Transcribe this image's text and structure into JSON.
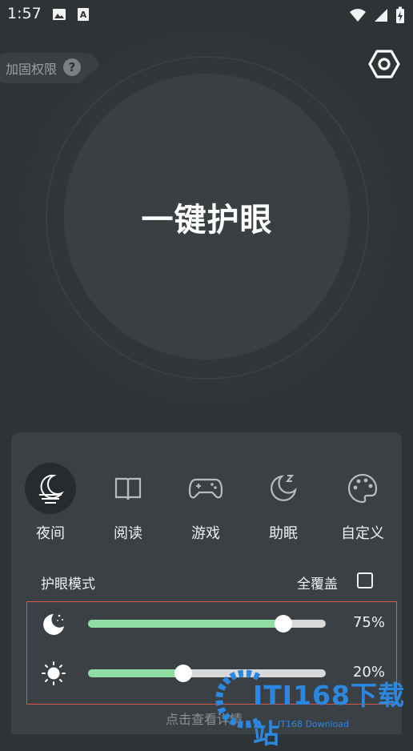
{
  "status_bar": {
    "time": "1:57",
    "left_icons": [
      "image-icon",
      "text-a-icon"
    ],
    "right_icons": [
      "wifi-icon",
      "signal-icon",
      "battery-charging-icon"
    ]
  },
  "permission": {
    "label": "加固权限",
    "help": "?"
  },
  "settings": {
    "icon": "settings-hex-icon"
  },
  "main_button": {
    "label": "一键护眼"
  },
  "modes": [
    {
      "label": "夜间",
      "icon": "night-mode-icon",
      "active": true
    },
    {
      "label": "阅读",
      "icon": "book-icon",
      "active": false
    },
    {
      "label": "游戏",
      "icon": "gamepad-icon",
      "active": false
    },
    {
      "label": "助眠",
      "icon": "sleep-moon-icon",
      "active": false
    },
    {
      "label": "自定义",
      "icon": "palette-icon",
      "active": false
    }
  ],
  "eye_mode": {
    "title": "护眼模式",
    "cover_label": "全覆盖",
    "cover_checked": false
  },
  "sliders": [
    {
      "name": "filter-intensity",
      "icon": "moon-stars-icon",
      "value_label": "75%",
      "value": 0.82
    },
    {
      "name": "brightness",
      "icon": "sun-icon",
      "value_label": "20%",
      "value": 0.4
    }
  ],
  "details_link": "点击查看详情",
  "watermark": {
    "text": "ITI168下载站",
    "sub": "IT168 Download"
  },
  "colors": {
    "accent_green": "#8fdca5",
    "background": "#2e3336",
    "panel": "#3a4044",
    "highlight_border": "#d9534f",
    "watermark_blue": "#2b87e0"
  }
}
